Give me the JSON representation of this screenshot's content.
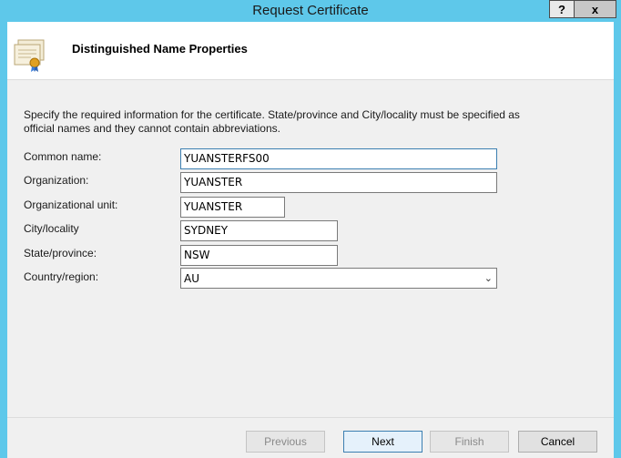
{
  "window": {
    "title": "Request Certificate",
    "help_label": "?",
    "close_label": "x"
  },
  "header": {
    "title": "Distinguished Name Properties"
  },
  "description": "Specify the required information for the certificate. State/province and City/locality must be specified as official names and they cannot contain abbreviations.",
  "form": {
    "common_name": {
      "label": "Common name:",
      "value": "YUANSTERFS00"
    },
    "organization": {
      "label": "Organization:",
      "value": "YUANSTER"
    },
    "org_unit": {
      "label": "Organizational unit:",
      "value": "YUANSTER"
    },
    "city": {
      "label": "City/locality",
      "value": "SYDNEY"
    },
    "state": {
      "label": "State/province:",
      "value": "NSW"
    },
    "country": {
      "label": "Country/region:",
      "value": "AU"
    }
  },
  "buttons": {
    "previous": "Previous",
    "next": "Next",
    "finish": "Finish",
    "cancel": "Cancel"
  },
  "colors": {
    "title_bar": "#5ec8ea",
    "client_bg": "#f0f0f0",
    "focus_border": "#3c7fb1"
  }
}
